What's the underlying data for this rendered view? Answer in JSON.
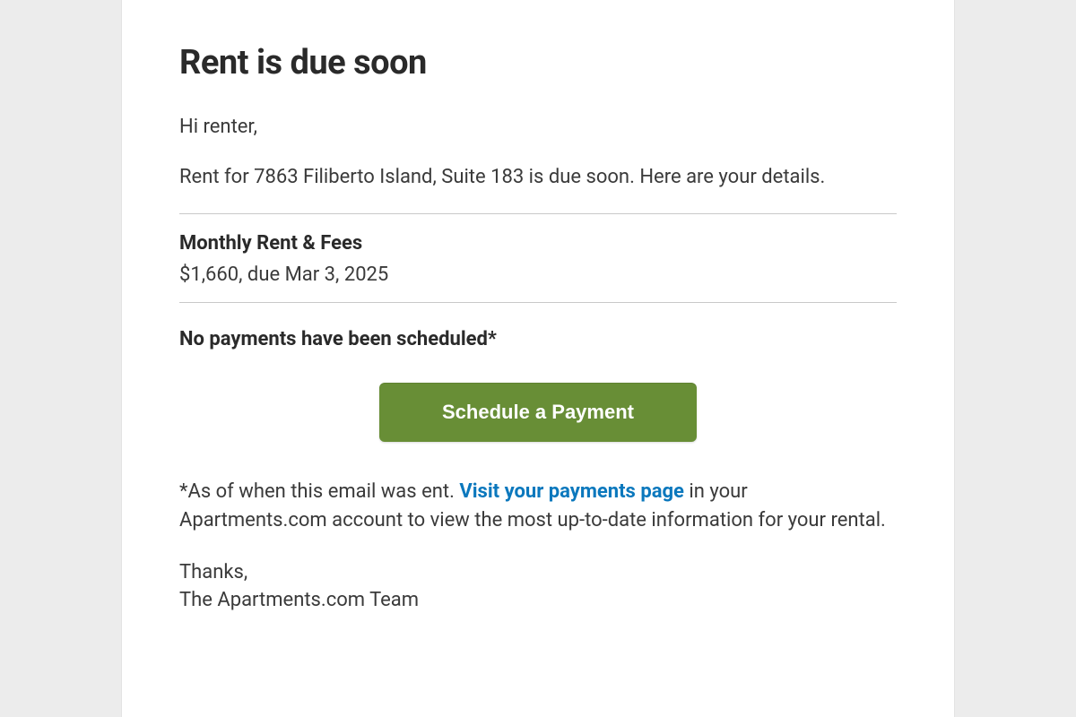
{
  "title": "Rent is due soon",
  "greeting": "Hi renter,",
  "intro": "Rent for 7863 Filiberto Island, Suite 183 is due soon. Here are your details.",
  "rent": {
    "label": "Monthly Rent & Fees",
    "value": "$1,660, due Mar 3, 2025"
  },
  "no_payments": "No payments have been scheduled*",
  "cta": {
    "label": "Schedule a Payment"
  },
  "footnote": {
    "prefix": "*As of when this email was ent. ",
    "link_text": "Visit your payments page",
    "suffix": " in your Apartments.com account to view the most up-to-date information for your rental."
  },
  "signoff": {
    "thanks": "Thanks,",
    "team": "The Apartments.com Team"
  }
}
